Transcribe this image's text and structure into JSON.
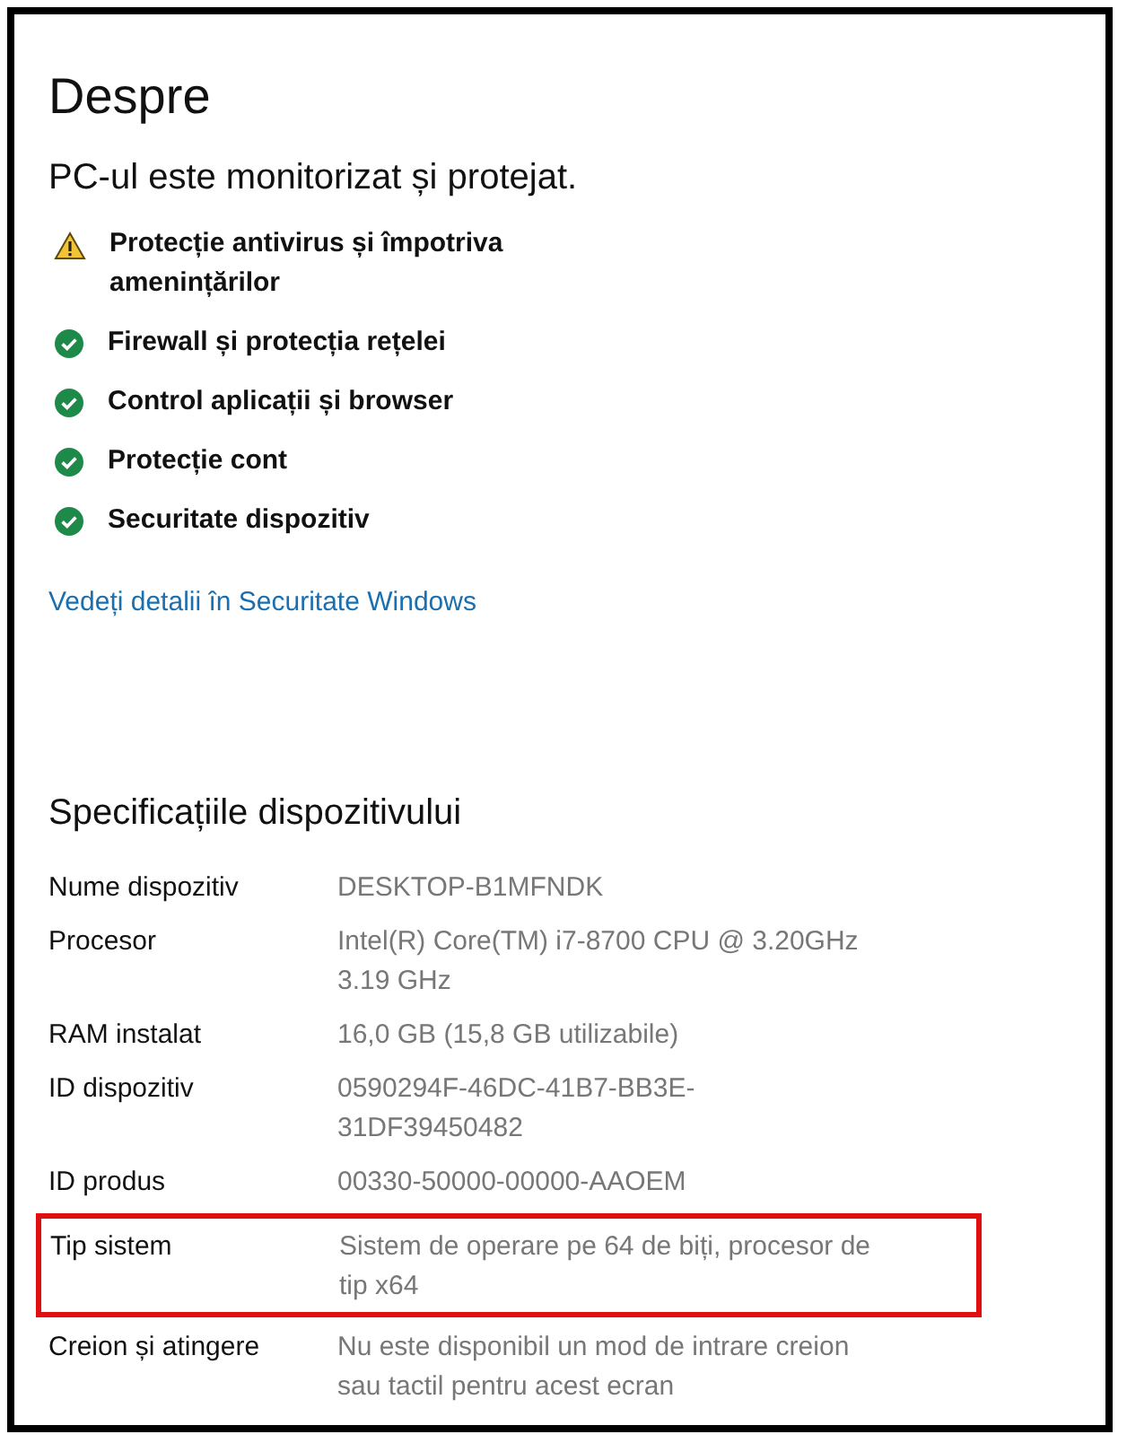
{
  "title": "Despre",
  "protection": {
    "heading": "PC-ul este monitorizat și protejat.",
    "items": [
      {
        "kind": "warning",
        "label": "Protecție antivirus și împotriva amenințărilor"
      },
      {
        "kind": "ok",
        "label": "Firewall și protecția rețelei"
      },
      {
        "kind": "ok",
        "label": "Control aplicații și browser"
      },
      {
        "kind": "ok",
        "label": "Protecție cont"
      },
      {
        "kind": "ok",
        "label": "Securitate dispozitiv"
      }
    ],
    "link": "Vedeți detalii în Securitate Windows"
  },
  "specs": {
    "heading": "Specificațiile dispozitivului",
    "rows": [
      {
        "label": "Nume dispozitiv",
        "value": "DESKTOP-B1MFNDK",
        "highlighted": false
      },
      {
        "label": "Procesor",
        "value": "Intel(R) Core(TM) i7-8700 CPU @ 3.20GHz 3.19 GHz",
        "highlighted": false
      },
      {
        "label": "RAM instalat",
        "value": "16,0 GB (15,8 GB utilizabile)",
        "highlighted": false
      },
      {
        "label": "ID dispozitiv",
        "value": "0590294F-46DC-41B7-BB3E-31DF39450482",
        "highlighted": false
      },
      {
        "label": "ID produs",
        "value": "00330-50000-00000-AAOEM",
        "highlighted": false
      },
      {
        "label": "Tip sistem",
        "value": "Sistem de operare pe 64 de biți, procesor de tip x64",
        "highlighted": true
      },
      {
        "label": "Creion și atingere",
        "value": "Nu este disponibil un mod de intrare creion sau tactil pentru acest ecran",
        "highlighted": false
      }
    ]
  }
}
